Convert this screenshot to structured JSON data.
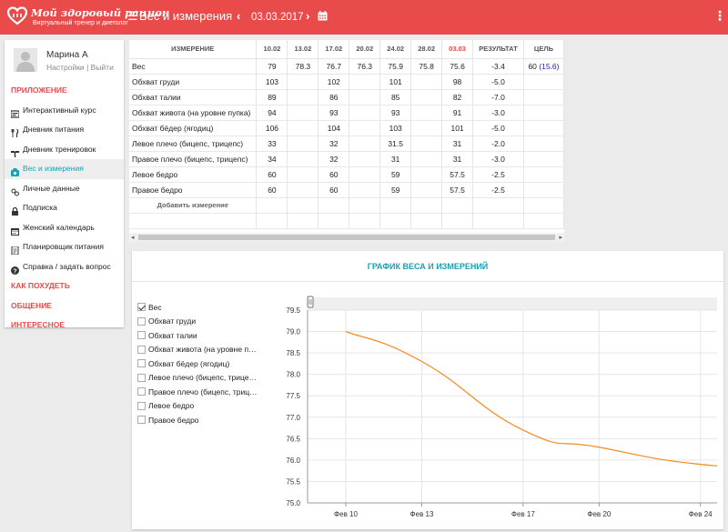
{
  "header": {
    "logo_title": "Мой здоровый рацион",
    "logo_subtitle": "Виртуальный тренер и диетолог",
    "page_title": "Вес и измерения",
    "date": "03.03.2017",
    "accent": "#e94b4b"
  },
  "user": {
    "name": "Марина А",
    "settings": "Настройки",
    "separator": "|",
    "logout": "Выйти"
  },
  "nav": [
    {
      "label": "ПРИЛОЖЕНИЕ",
      "section": true
    },
    {
      "label": "Интерактивный курс",
      "icon": "course-icon"
    },
    {
      "label": "Дневник питания",
      "icon": "fork-knife-icon"
    },
    {
      "label": "Дневник тренировок",
      "icon": "dumbbell-icon"
    },
    {
      "label": "Вес и измерения",
      "icon": "scale-icon",
      "active": true
    },
    {
      "label": "Личные данные",
      "icon": "users-icon"
    },
    {
      "label": "Подписка",
      "icon": "lock-icon"
    },
    {
      "label": "Женский календарь",
      "icon": "calendar-icon"
    },
    {
      "label": "Планировщик питания",
      "icon": "document-icon"
    },
    {
      "label": "Справка / задать вопрос",
      "icon": "help-icon"
    },
    {
      "label": "КАК ПОХУДЕТЬ",
      "section": true
    },
    {
      "label": "ОБЩЕНИЕ",
      "section": true
    },
    {
      "label": "ИНТЕРЕСНОЕ",
      "section": true
    }
  ],
  "table": {
    "headers": [
      "ИЗМЕРЕНИЕ",
      "10.02",
      "13.02",
      "17.02",
      "20.02",
      "24.02",
      "28.02",
      "03.03",
      "РЕЗУЛЬТАТ",
      "ЦЕЛЬ"
    ],
    "rows": [
      {
        "name": "Вес",
        "values": [
          "79",
          "78.3",
          "76.7",
          "76.3",
          "75.9",
          "75.8",
          "75.6"
        ],
        "result": "-3.4",
        "goal": "60",
        "goal_extra": "(15.6)"
      },
      {
        "name": "Обхват груди",
        "values": [
          "103",
          "",
          "102",
          "",
          "101",
          "",
          "98"
        ],
        "result": "-5.0",
        "goal": "",
        "goal_extra": ""
      },
      {
        "name": "Обхват талии",
        "values": [
          "89",
          "",
          "86",
          "",
          "85",
          "",
          "82"
        ],
        "result": "-7.0",
        "goal": "",
        "goal_extra": ""
      },
      {
        "name": "Обхват живота (на уровне пупка)",
        "values": [
          "94",
          "",
          "93",
          "",
          "93",
          "",
          "91"
        ],
        "result": "-3.0",
        "goal": "",
        "goal_extra": ""
      },
      {
        "name": "Обхват бёдер (ягодиц)",
        "values": [
          "106",
          "",
          "104",
          "",
          "103",
          "",
          "101"
        ],
        "result": "-5.0",
        "goal": "",
        "goal_extra": ""
      },
      {
        "name": "Левое плечо (бицепс, трицепс)",
        "values": [
          "33",
          "",
          "32",
          "",
          "31.5",
          "",
          "31"
        ],
        "result": "-2.0",
        "goal": "",
        "goal_extra": ""
      },
      {
        "name": "Правое плечо (бицепс, трицепс)",
        "values": [
          "34",
          "",
          "32",
          "",
          "31",
          "",
          "31"
        ],
        "result": "-3.0",
        "goal": "",
        "goal_extra": ""
      },
      {
        "name": "Левое бедро",
        "values": [
          "60",
          "",
          "60",
          "",
          "59",
          "",
          "57.5"
        ],
        "result": "-2.5",
        "goal": "",
        "goal_extra": ""
      },
      {
        "name": "Правое бедро",
        "values": [
          "60",
          "",
          "60",
          "",
          "59",
          "",
          "57.5"
        ],
        "result": "-2.5",
        "goal": "",
        "goal_extra": ""
      }
    ],
    "add_label": "Добавить измерение"
  },
  "chart_panel": {
    "title": "ГРАФИК ВЕСА И ИЗМЕРЕНИЙ",
    "legend": [
      {
        "label": "Вес",
        "checked": true
      },
      {
        "label": "Обхват груди",
        "checked": false
      },
      {
        "label": "Обхват талии",
        "checked": false
      },
      {
        "label": "Обхват живота (на уровне пупка)",
        "checked": false
      },
      {
        "label": "Обхват бёдер (ягодиц)",
        "checked": false
      },
      {
        "label": "Левое плечо (бицепс, трицепс)",
        "checked": false
      },
      {
        "label": "Правое плечо (бицепс, трицепс)",
        "checked": false
      },
      {
        "label": "Левое бедро",
        "checked": false
      },
      {
        "label": "Правое бедро",
        "checked": false
      }
    ]
  },
  "chart_data": {
    "type": "line",
    "title": "",
    "xlabel": "",
    "ylabel": "",
    "x": [
      "2017-02-10",
      "2017-02-13",
      "2017-02-17",
      "2017-02-20",
      "2017-02-24",
      "2017-02-28",
      "2017-03-03"
    ],
    "series": [
      {
        "name": "Вес",
        "values": [
          79,
          78.3,
          76.7,
          76.3,
          75.9,
          75.8,
          75.6
        ],
        "color": "#f58a1f"
      }
    ],
    "ylim": [
      75.0,
      79.5
    ],
    "yticks": [
      "75.0",
      "75.5",
      "76.0",
      "76.5",
      "77.0",
      "77.5",
      "78.0",
      "78.5",
      "79.0",
      "79.5"
    ],
    "xticks": [
      {
        "date": "2017-02-10",
        "label": "Фев 10"
      },
      {
        "date": "2017-02-13",
        "label": "Фев 13"
      },
      {
        "date": "2017-02-17",
        "label": "Фев 17"
      },
      {
        "date": "2017-02-20",
        "label": "Фев 20"
      },
      {
        "date": "2017-02-24",
        "label": "Фев 24"
      }
    ],
    "grid": true
  }
}
